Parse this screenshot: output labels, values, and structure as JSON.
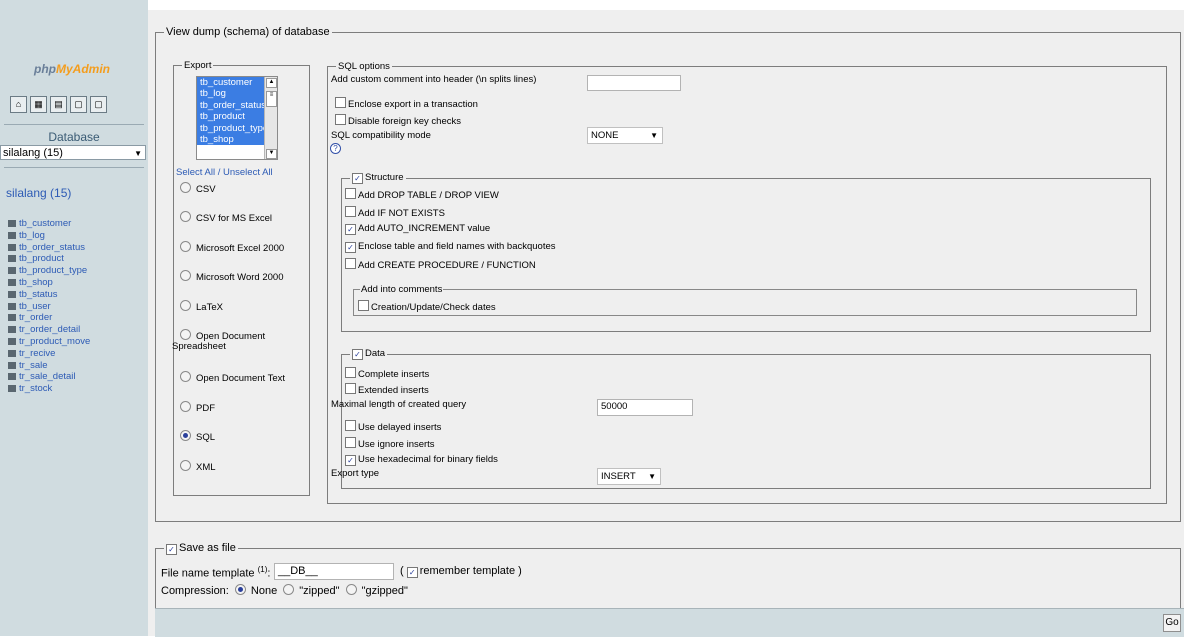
{
  "sidebar": {
    "logo_part1": "php",
    "logo_part2": "MyAdmin",
    "quick_icons": [
      "home-icon",
      "query-window-icon",
      "sql-icon",
      "docs-icon",
      "help-icon"
    ],
    "database_label": "Database",
    "database_selected": "silalang (15)",
    "database_link": "silalang (15)",
    "tables": [
      "tb_customer",
      "tb_log",
      "tb_order_status",
      "tb_product",
      "tb_product_type",
      "tb_shop",
      "tb_status",
      "tb_user",
      "tr_order",
      "tr_order_detail",
      "tr_product_move",
      "tr_recive",
      "tr_sale",
      "tr_sale_detail",
      "tr_stock"
    ]
  },
  "main": {
    "legend": "View dump (schema) of database",
    "export": {
      "legend": "Export",
      "listbox_items": [
        "tb_customer",
        "tb_log",
        "tb_order_status",
        "tb_product",
        "tb_product_type",
        "tb_shop"
      ],
      "select_all": "Select All / Unselect All",
      "formats": [
        {
          "label": "CSV",
          "selected": false
        },
        {
          "label": "CSV for MS Excel",
          "selected": false
        },
        {
          "label": "Microsoft Excel 2000",
          "selected": false
        },
        {
          "label": "Microsoft Word 2000",
          "selected": false
        },
        {
          "label": "LaTeX",
          "selected": false
        },
        {
          "label": "Open Document Spreadsheet",
          "line1": "Open Document",
          "line2": "Spreadsheet",
          "selected": false
        },
        {
          "label": "Open Document Text",
          "selected": false
        },
        {
          "label": "PDF",
          "selected": false
        },
        {
          "label": "SQL",
          "selected": true
        },
        {
          "label": "XML",
          "selected": false
        }
      ]
    },
    "sql_options": {
      "legend": "SQL options",
      "custom_comment_label": "Add custom comment into header (\\n splits lines)",
      "custom_comment_value": "",
      "enclose_transaction": "Enclose export in a transaction",
      "disable_fk": "Disable foreign key checks",
      "compat_label": "SQL compatibility mode",
      "compat_value": "NONE",
      "structure": {
        "legend": "Structure",
        "checked": true,
        "options": [
          {
            "label": "Add DROP TABLE / DROP VIEW",
            "checked": false
          },
          {
            "label": "Add IF NOT EXISTS",
            "checked": false
          },
          {
            "label": "Add AUTO_INCREMENT value",
            "checked": true
          },
          {
            "label": "Enclose table and field names with backquotes",
            "checked": true
          },
          {
            "label": "Add CREATE PROCEDURE / FUNCTION",
            "checked": false
          }
        ],
        "comments_legend": "Add into comments",
        "comments_option": "Creation/Update/Check dates"
      },
      "data": {
        "legend": "Data",
        "checked": true,
        "complete_inserts": "Complete inserts",
        "extended_inserts": "Extended inserts",
        "max_length_label": "Maximal length of created query",
        "max_length_value": "50000",
        "delayed_inserts": "Use delayed inserts",
        "ignore_inserts": "Use ignore inserts",
        "hex_binary": "Use hexadecimal for binary fields",
        "export_type_label": "Export type",
        "export_type_value": "INSERT"
      }
    },
    "save": {
      "legend": "Save as file",
      "checked": true,
      "filename_label": "File name template",
      "filename_sup": "(1)",
      "filename_colon": ":",
      "filename_value": "__DB__",
      "remember_open": "(",
      "remember_label": "remember template",
      "remember_close": ")",
      "compression_label": "Compression:",
      "compression_options": [
        "None",
        "\"zipped\"",
        "\"gzipped\""
      ],
      "compression_selected": "None"
    },
    "go_label": "Go"
  }
}
